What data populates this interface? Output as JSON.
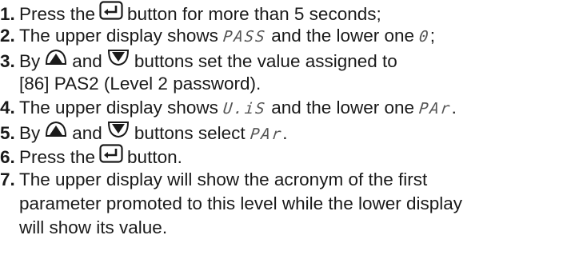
{
  "steps": [
    {
      "num": "1.",
      "a": "Press the",
      "icon": "enter-icon",
      "b": "button for more than 5 seconds;"
    },
    {
      "num": "2.",
      "a": "The upper display shows",
      "seg1": "PASS",
      "b": "and the lower one",
      "seg2": "0",
      "c": ";"
    },
    {
      "num": "3.",
      "a": "By",
      "icon1": "up-arrow-icon",
      "b": "and",
      "icon2": "down-arrow-icon",
      "c": "buttons set the value assigned to",
      "line2": "[86] PAS2 (Level 2 password)."
    },
    {
      "num": "4.",
      "a": "The upper display shows",
      "seg1": "U.iS",
      "b": "and the lower one",
      "seg2": "PAr",
      "c": "."
    },
    {
      "num": "5.",
      "a": "By",
      "icon1": "up-arrow-icon",
      "b": "and",
      "icon2": "down-arrow-icon",
      "c": "buttons select",
      "seg1": "PAr",
      "d": "."
    },
    {
      "num": "6.",
      "a": "Press the",
      "icon": "enter-icon",
      "b": "button."
    },
    {
      "num": "7.",
      "a": "The upper display will show the acronym of the first",
      "line2": "parameter promoted to this level while the lower display",
      "line3": "will show its value."
    }
  ]
}
